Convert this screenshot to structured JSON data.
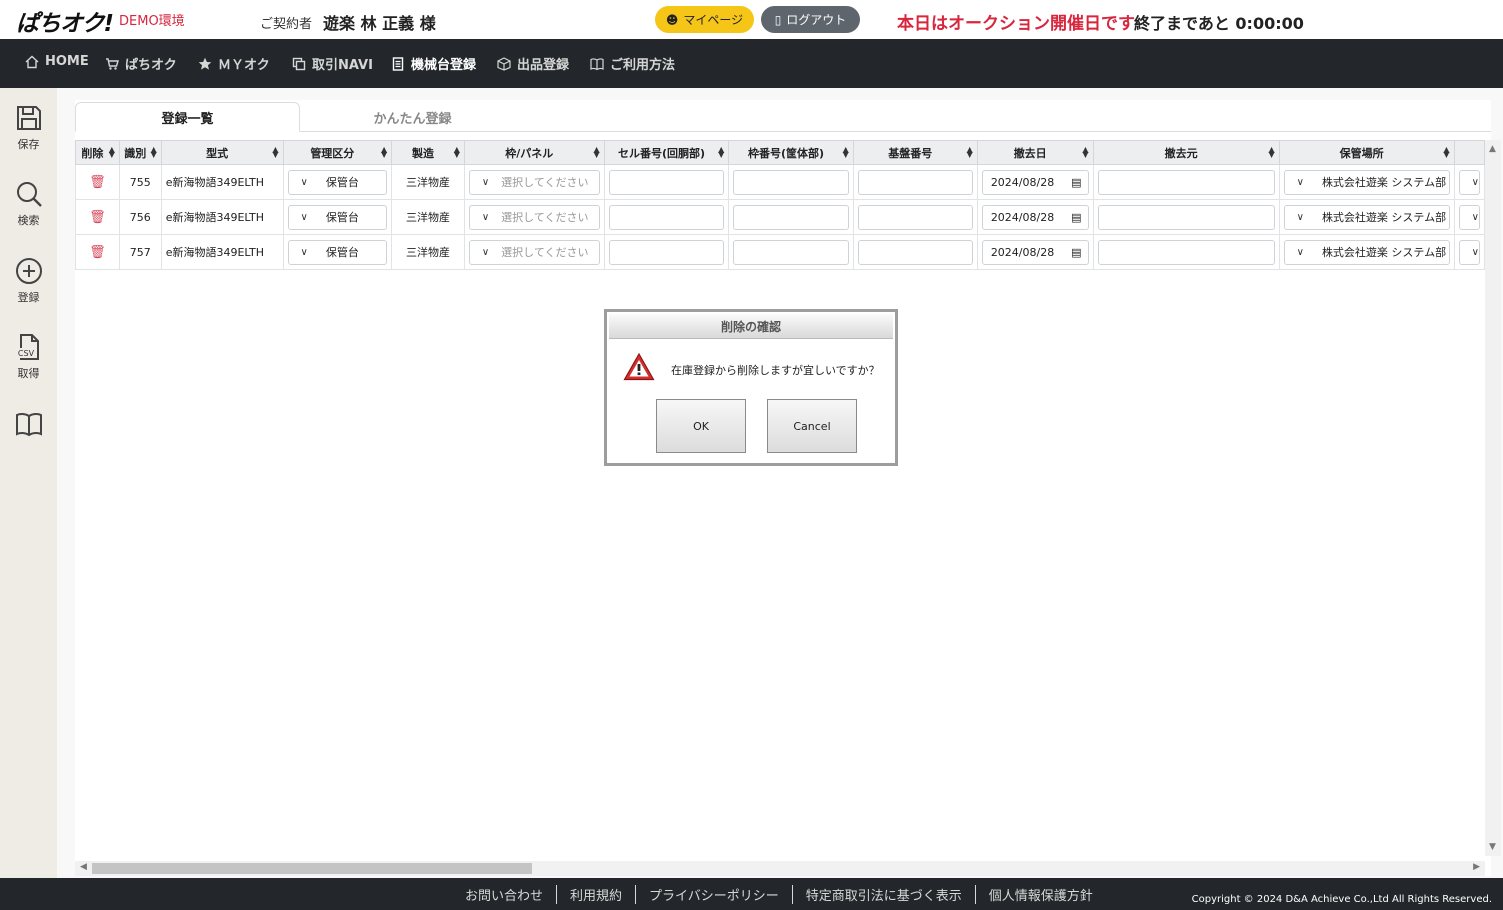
{
  "header": {
    "logo": "ぱちオク!",
    "demo_label": "DEMO環境",
    "contract_label": "ご契約者",
    "contract_name": "遊楽 林 正義 様",
    "mypage_label": "マイページ",
    "logout_label": "ログアウト",
    "notice": "本日はオークション開催日です",
    "remaining": "終了まであと 0:00:00"
  },
  "nav": {
    "items": [
      {
        "label": "HOME",
        "icon": "home-icon"
      },
      {
        "label": "ぱちオク",
        "icon": "cart-icon"
      },
      {
        "label": "ＭＹオク",
        "icon": "star-icon"
      },
      {
        "label": "取引NAVI",
        "icon": "copy-icon"
      },
      {
        "label": "機械台登録",
        "icon": "document-icon"
      },
      {
        "label": "出品登録",
        "icon": "box-icon"
      },
      {
        "label": "ご利用方法",
        "icon": "book-icon"
      }
    ]
  },
  "sidebar": {
    "items": [
      {
        "label": "保存",
        "icon": "save-icon"
      },
      {
        "label": "検索",
        "icon": "search-icon"
      },
      {
        "label": "登録",
        "icon": "plus-circle-icon"
      },
      {
        "label": "取得",
        "icon": "csv-file-icon",
        "badge": "CSV"
      },
      {
        "label": "",
        "icon": "book-icon"
      }
    ]
  },
  "tabs": {
    "list": "登録一覧",
    "easy": "かんたん登録"
  },
  "table": {
    "headers": [
      "削除",
      "識別",
      "型式",
      "管理区分",
      "製造",
      "枠/パネル",
      "セル番号(回胴部)",
      "枠番号(筐体部)",
      "基盤番号",
      "撤去日",
      "撤去元",
      "保管場所"
    ],
    "rows": [
      {
        "id": "755",
        "model": "e新海物語349ELTH",
        "category": "保管台",
        "maker": "三洋物産",
        "panel": "選択してください",
        "removal_date": "2024/08/28",
        "location": "株式会社遊楽 システム部"
      },
      {
        "id": "756",
        "model": "e新海物語349ELTH",
        "category": "保管台",
        "maker": "三洋物産",
        "panel": "選択してください",
        "removal_date": "2024/08/28",
        "location": "株式会社遊楽 システム部"
      },
      {
        "id": "757",
        "model": "e新海物語349ELTH",
        "category": "保管台",
        "maker": "三洋物産",
        "panel": "選択してください",
        "removal_date": "2024/08/28",
        "location": "株式会社遊楽 システム部"
      }
    ]
  },
  "dialog": {
    "title": "削除の確認",
    "message": "在庫登録から削除しますが宜しいですか？",
    "ok": "OK",
    "cancel": "Cancel"
  },
  "footer": {
    "links": [
      "お問い合わせ",
      "利用規約",
      "プライバシーポリシー",
      "特定商取引法に基づく表示",
      "個人情報保護方針"
    ],
    "copyright": "Copyright © 2024 D&A Achieve Co.,Ltd All Rights Reserved."
  },
  "colors": {
    "accent_red": "#d7263d",
    "mypage_yellow": "#f5c518",
    "logout_gray": "#5f656d",
    "nav_dark": "#23272b"
  }
}
